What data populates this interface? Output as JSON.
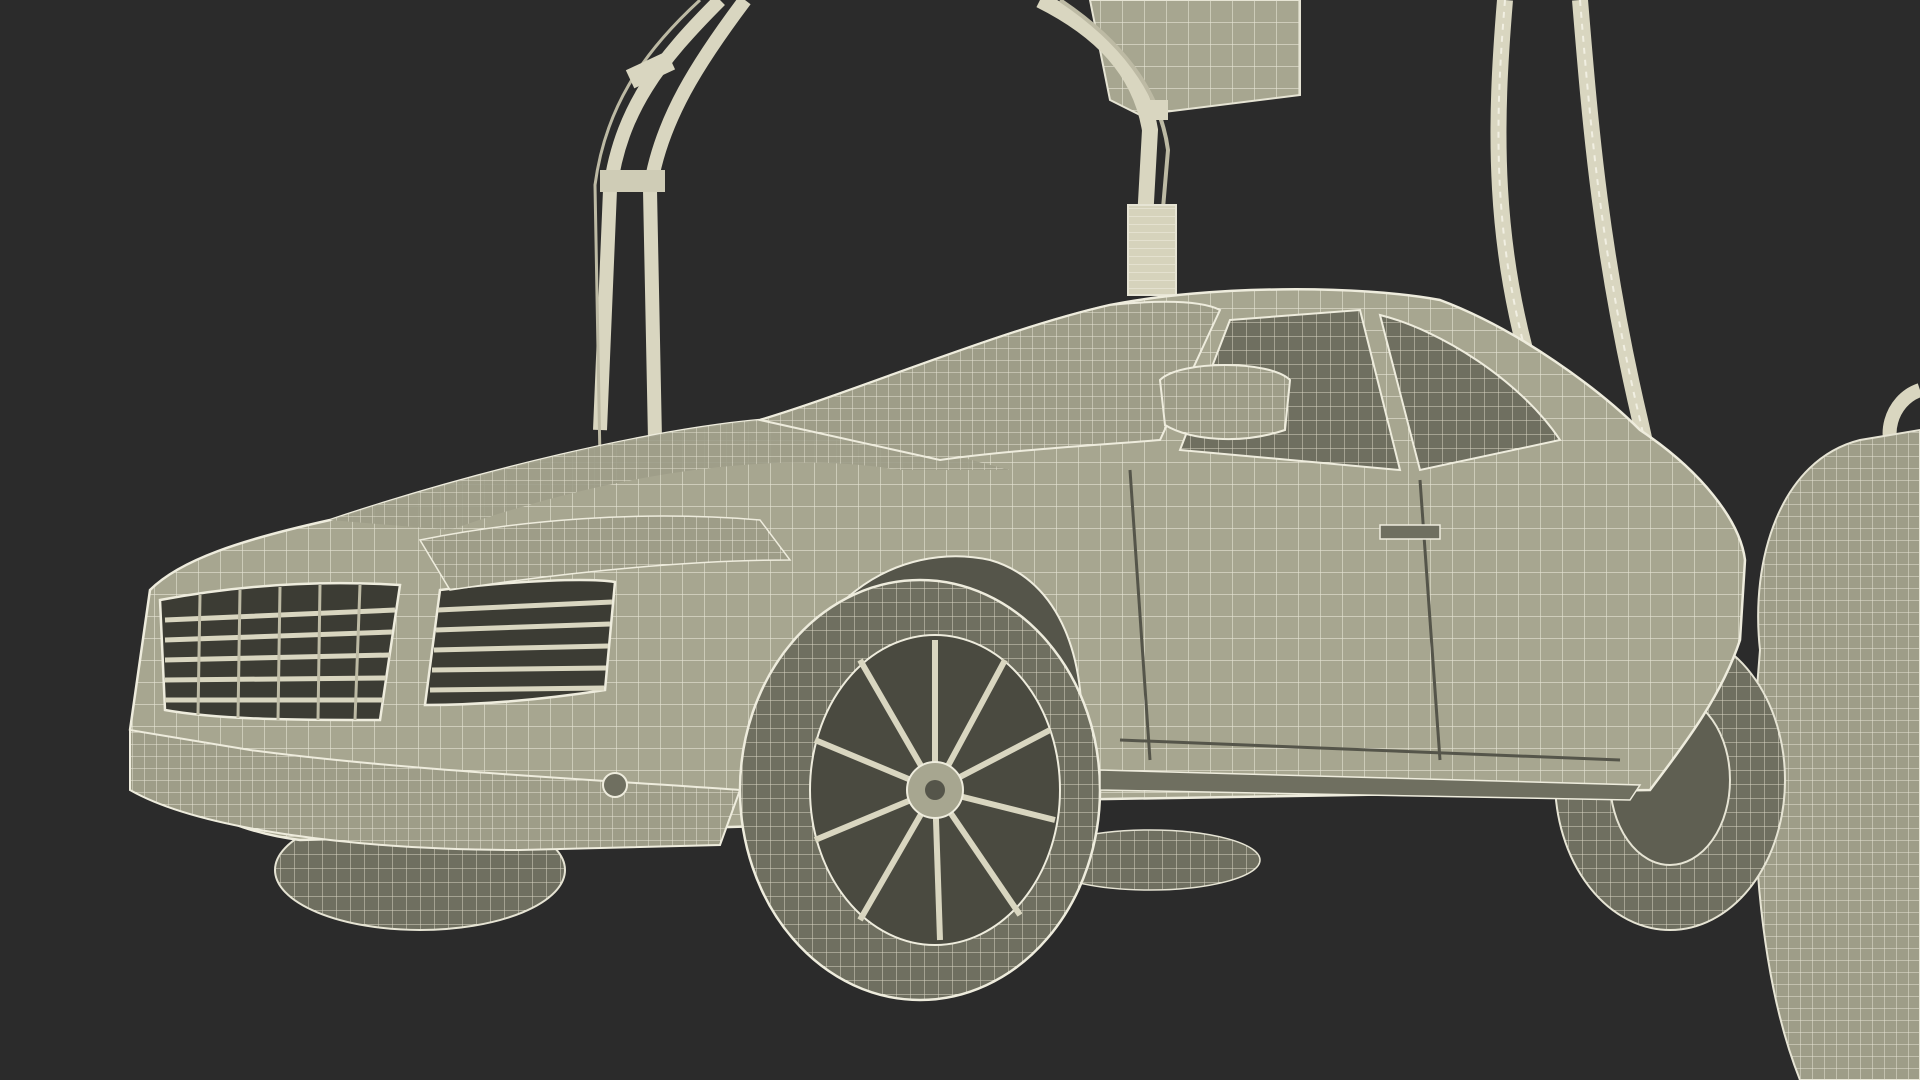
{
  "scene": {
    "background_color": "#2b2b2b",
    "mesh_fill_color": "#a6a58f",
    "mesh_line_color": "#e4e2d2",
    "mesh_dark_color": "#55554a",
    "hose_color": "#d9d6c0",
    "icons": [
      "car-icon",
      "charging-station-icon",
      "charging-cable-icon",
      "wheel-icon"
    ]
  }
}
